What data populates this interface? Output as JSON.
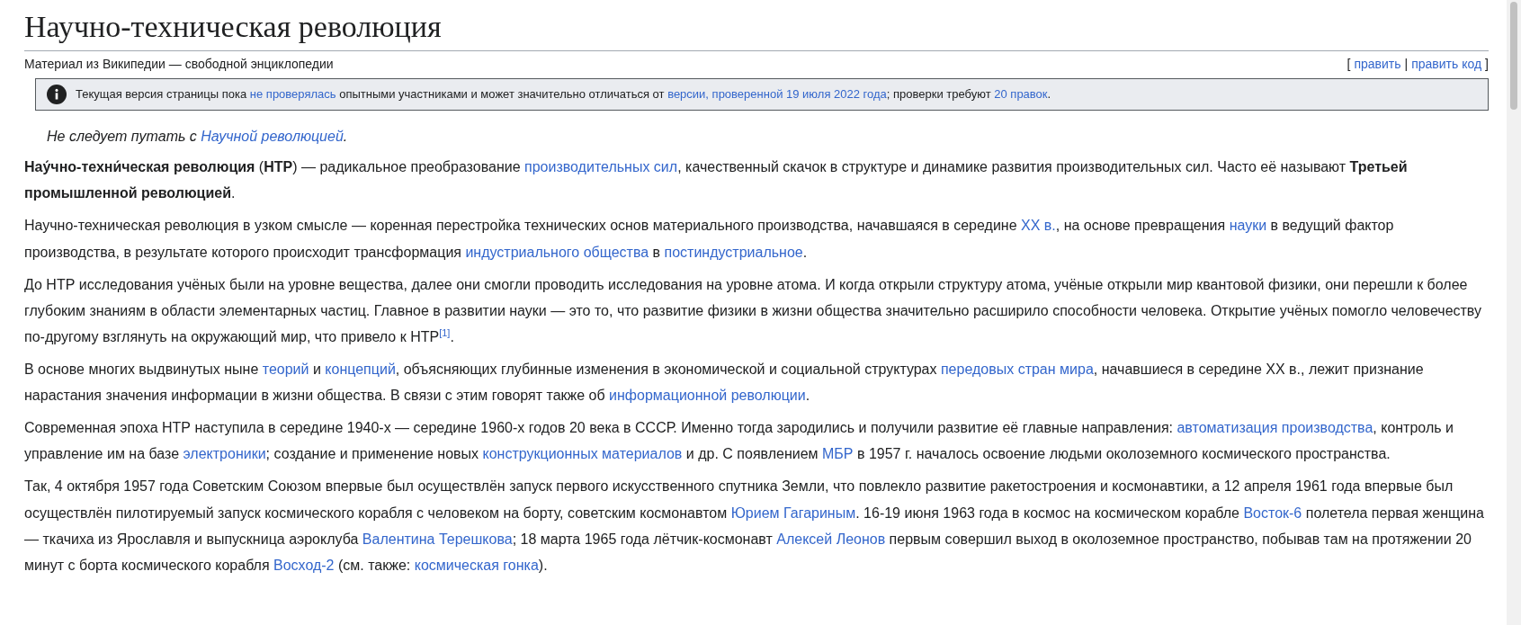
{
  "title": "Научно-техническая революция",
  "subtitle": "Материал из Википедии — свободной энциклопедии",
  "edit_links": {
    "open": "[",
    "items": [
      "править",
      "править код"
    ],
    "separator": "|",
    "close": "]"
  },
  "notice": [
    {
      "kind": "text",
      "text": "Текущая версия страницы пока "
    },
    {
      "kind": "link",
      "text": "не проверялась"
    },
    {
      "kind": "text",
      "text": " опытными участниками и может значительно отличаться от "
    },
    {
      "kind": "link",
      "text": "версии, проверенной 19 июля 2022 года"
    },
    {
      "kind": "text",
      "text": "; проверки требуют "
    },
    {
      "kind": "link",
      "text": "20 правок"
    },
    {
      "kind": "text",
      "text": "."
    }
  ],
  "hatnote": [
    {
      "kind": "text",
      "text": "Не следует путать с "
    },
    {
      "kind": "link",
      "text": "Научной революцией"
    },
    {
      "kind": "text",
      "text": "."
    }
  ],
  "paragraphs": [
    [
      {
        "kind": "text",
        "text": "**Нау́чно-техни́ческая революция** (**НТР**) — радикальное преобразование "
      },
      {
        "kind": "link",
        "text": "производительных сил"
      },
      {
        "kind": "text",
        "text": ", качественный скачок в структуре и динамике развития производительных сил. Часто её называют **Третьей промышленной революцией**."
      }
    ],
    [
      {
        "kind": "text",
        "text": "Научно-техническая революция в узком смысле — коренная перестройка технических основ материального производства, начавшаяся в середине "
      },
      {
        "kind": "link",
        "text": "XX в."
      },
      {
        "kind": "text",
        "text": ", на основе превращения "
      },
      {
        "kind": "link",
        "text": "науки"
      },
      {
        "kind": "text",
        "text": " в ведущий фактор производства, в результате которого происходит трансформация "
      },
      {
        "kind": "link",
        "text": "индустриального общества"
      },
      {
        "kind": "text",
        "text": " в "
      },
      {
        "kind": "link",
        "text": "постиндустриальное"
      },
      {
        "kind": "text",
        "text": "."
      }
    ],
    [
      {
        "kind": "text",
        "text": "До НТР исследования учёных были на уровне вещества, далее они смогли проводить исследования на уровне атома. И когда открыли структуру атома, учёные открыли мир квантовой физики, они перешли к более глубоким знаниям в области элементарных частиц. Главное в развитии науки — это то, что развитие физики в жизни общества значительно расширило способности человека. Открытие учёных помогло человечеству по-другому взглянуть на окружающий мир, что привело к НТР"
      },
      {
        "kind": "ref",
        "text": "[1]"
      },
      {
        "kind": "text",
        "text": "."
      }
    ],
    [
      {
        "kind": "text",
        "text": "В основе многих выдвинутых ныне "
      },
      {
        "kind": "link",
        "text": "теорий"
      },
      {
        "kind": "text",
        "text": " и "
      },
      {
        "kind": "link",
        "text": "концепций"
      },
      {
        "kind": "text",
        "text": ", объясняющих глубинные изменения в экономической и социальной структурах "
      },
      {
        "kind": "link",
        "text": "передовых стран мира"
      },
      {
        "kind": "text",
        "text": ", начавшиеся в середине XX в., лежит признание нарастания значения информации в жизни общества. В связи с этим говорят также об "
      },
      {
        "kind": "link",
        "text": "информационной революции"
      },
      {
        "kind": "text",
        "text": "."
      }
    ],
    [
      {
        "kind": "text",
        "text": "Современная эпоха НТР наступила в середине 1940-х — середине 1960-х годов 20 века в СССР. Именно тогда зародились и получили развитие её главные направления: "
      },
      {
        "kind": "link",
        "text": "автоматизация производства"
      },
      {
        "kind": "text",
        "text": ", контроль и управление им на базе "
      },
      {
        "kind": "link",
        "text": "электроники"
      },
      {
        "kind": "text",
        "text": "; создание и применение новых "
      },
      {
        "kind": "link",
        "text": "конструкционных материалов"
      },
      {
        "kind": "text",
        "text": " и др. С появлением "
      },
      {
        "kind": "link",
        "text": "МБР"
      },
      {
        "kind": "text",
        "text": " в 1957 г. началось освоение людьми околоземного космического пространства."
      }
    ],
    [
      {
        "kind": "text",
        "text": "Так, 4 октября 1957 года Советским Союзом впервые был осуществлён запуск первого искусственного спутника Земли, что повлекло развитие ракетостроения и космонавтики, а 12 апреля 1961 года впервые был осуществлён пилотируемый запуск космического корабля с человеком на борту, советским космонавтом "
      },
      {
        "kind": "link",
        "text": "Юрием Гагариным"
      },
      {
        "kind": "text",
        "text": ". 16-19 июня 1963 года в космос на космическом корабле "
      },
      {
        "kind": "link",
        "text": "Восток-6"
      },
      {
        "kind": "text",
        "text": " полетела первая женщина — ткачиха из Ярославля и выпускница аэроклуба "
      },
      {
        "kind": "link",
        "text": "Валентина Терешкова"
      },
      {
        "kind": "text",
        "text": "; 18 марта 1965 года лётчик-космонавт "
      },
      {
        "kind": "link",
        "text": "Алексей Леонов"
      },
      {
        "kind": "text",
        "text": " первым совершил выход в околоземное пространство, побывав там на протяжении 20 минут с борта космического корабля "
      },
      {
        "kind": "link",
        "text": "Восход-2"
      },
      {
        "kind": "text",
        "text": " (см. также: "
      },
      {
        "kind": "link",
        "text": "космическая гонка"
      },
      {
        "kind": "text",
        "text": ")."
      }
    ]
  ]
}
